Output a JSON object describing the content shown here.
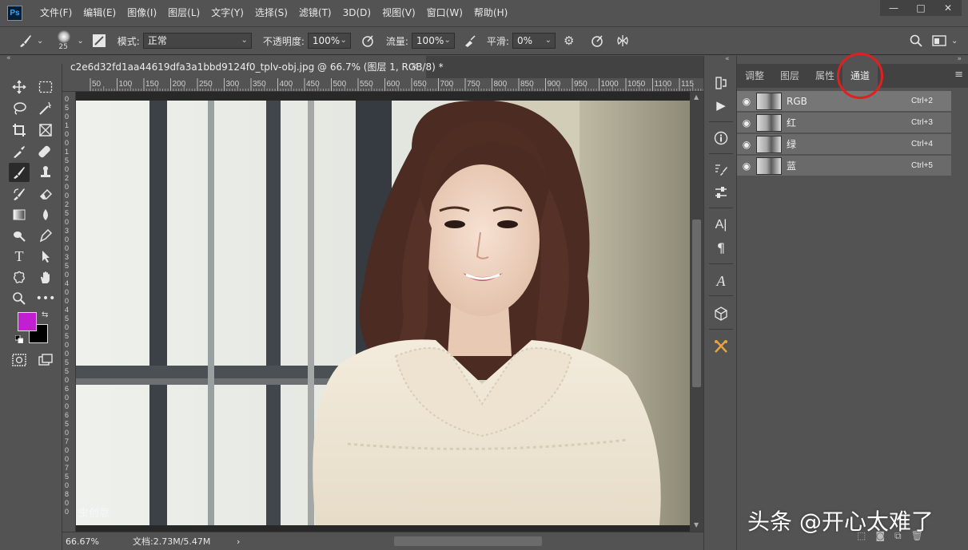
{
  "menubar": {
    "logo": "Ps",
    "items": [
      "文件(F)",
      "编辑(E)",
      "图像(I)",
      "图层(L)",
      "文字(Y)",
      "选择(S)",
      "滤镜(T)",
      "3D(D)",
      "视图(V)",
      "窗口(W)",
      "帮助(H)"
    ],
    "window_controls": [
      "—",
      "□",
      "✕"
    ]
  },
  "options": {
    "brush_size": "25",
    "mode_label": "模式:",
    "mode_value": "正常",
    "opacity_label": "不透明度:",
    "opacity_value": "100%",
    "flow_label": "流量:",
    "flow_value": "100%",
    "smooth_label": "平滑:",
    "smooth_value": "0%"
  },
  "document": {
    "tab_title": "c2e6d32fd1aa44619dfa3a1bbd9124f0_tplv-obj.jpg @ 66.7% (图层 1, RGB/8) *",
    "close": "✕",
    "ruler_ticks": [
      "50",
      "100",
      "150",
      "200",
      "250",
      "300",
      "350",
      "400",
      "450",
      "500",
      "550",
      "600",
      "650",
      "700",
      "750",
      "800",
      "850",
      "900",
      "950",
      "1000",
      "1050",
      "1100",
      "115"
    ],
    "vruler_ticks": [
      "0",
      "5",
      "0",
      "1",
      "0",
      "0",
      "1",
      "5",
      "0",
      "2",
      "0",
      "0",
      "2",
      "5",
      "0",
      "3",
      "0",
      "0",
      "3",
      "5",
      "0",
      "4",
      "0",
      "0",
      "4",
      "5",
      "0",
      "5",
      "0",
      "0",
      "5",
      "5",
      "0",
      "6",
      "0",
      "0",
      "6",
      "5",
      "0",
      "7",
      "0",
      "0",
      "7",
      "5",
      "0",
      "8",
      "0",
      "0"
    ],
    "photo_watermark": "虫创意"
  },
  "status": {
    "zoom": "66.67%",
    "doc_info": "文档:2.73M/5.47M",
    "arrow": "›"
  },
  "colors": {
    "foreground": "#c21fd0",
    "background": "#000000",
    "accent_circle": "#e02020"
  },
  "panel": {
    "tabs": [
      "调整",
      "图层",
      "属性",
      "通道"
    ],
    "active_tab": "通道",
    "channels": [
      {
        "name": "RGB",
        "shortcut": "Ctrl+2"
      },
      {
        "name": "红",
        "shortcut": "Ctrl+3"
      },
      {
        "name": "绿",
        "shortcut": "Ctrl+4"
      },
      {
        "name": "蓝",
        "shortcut": "Ctrl+5"
      }
    ]
  },
  "watermark": "头条 @开心太难了"
}
